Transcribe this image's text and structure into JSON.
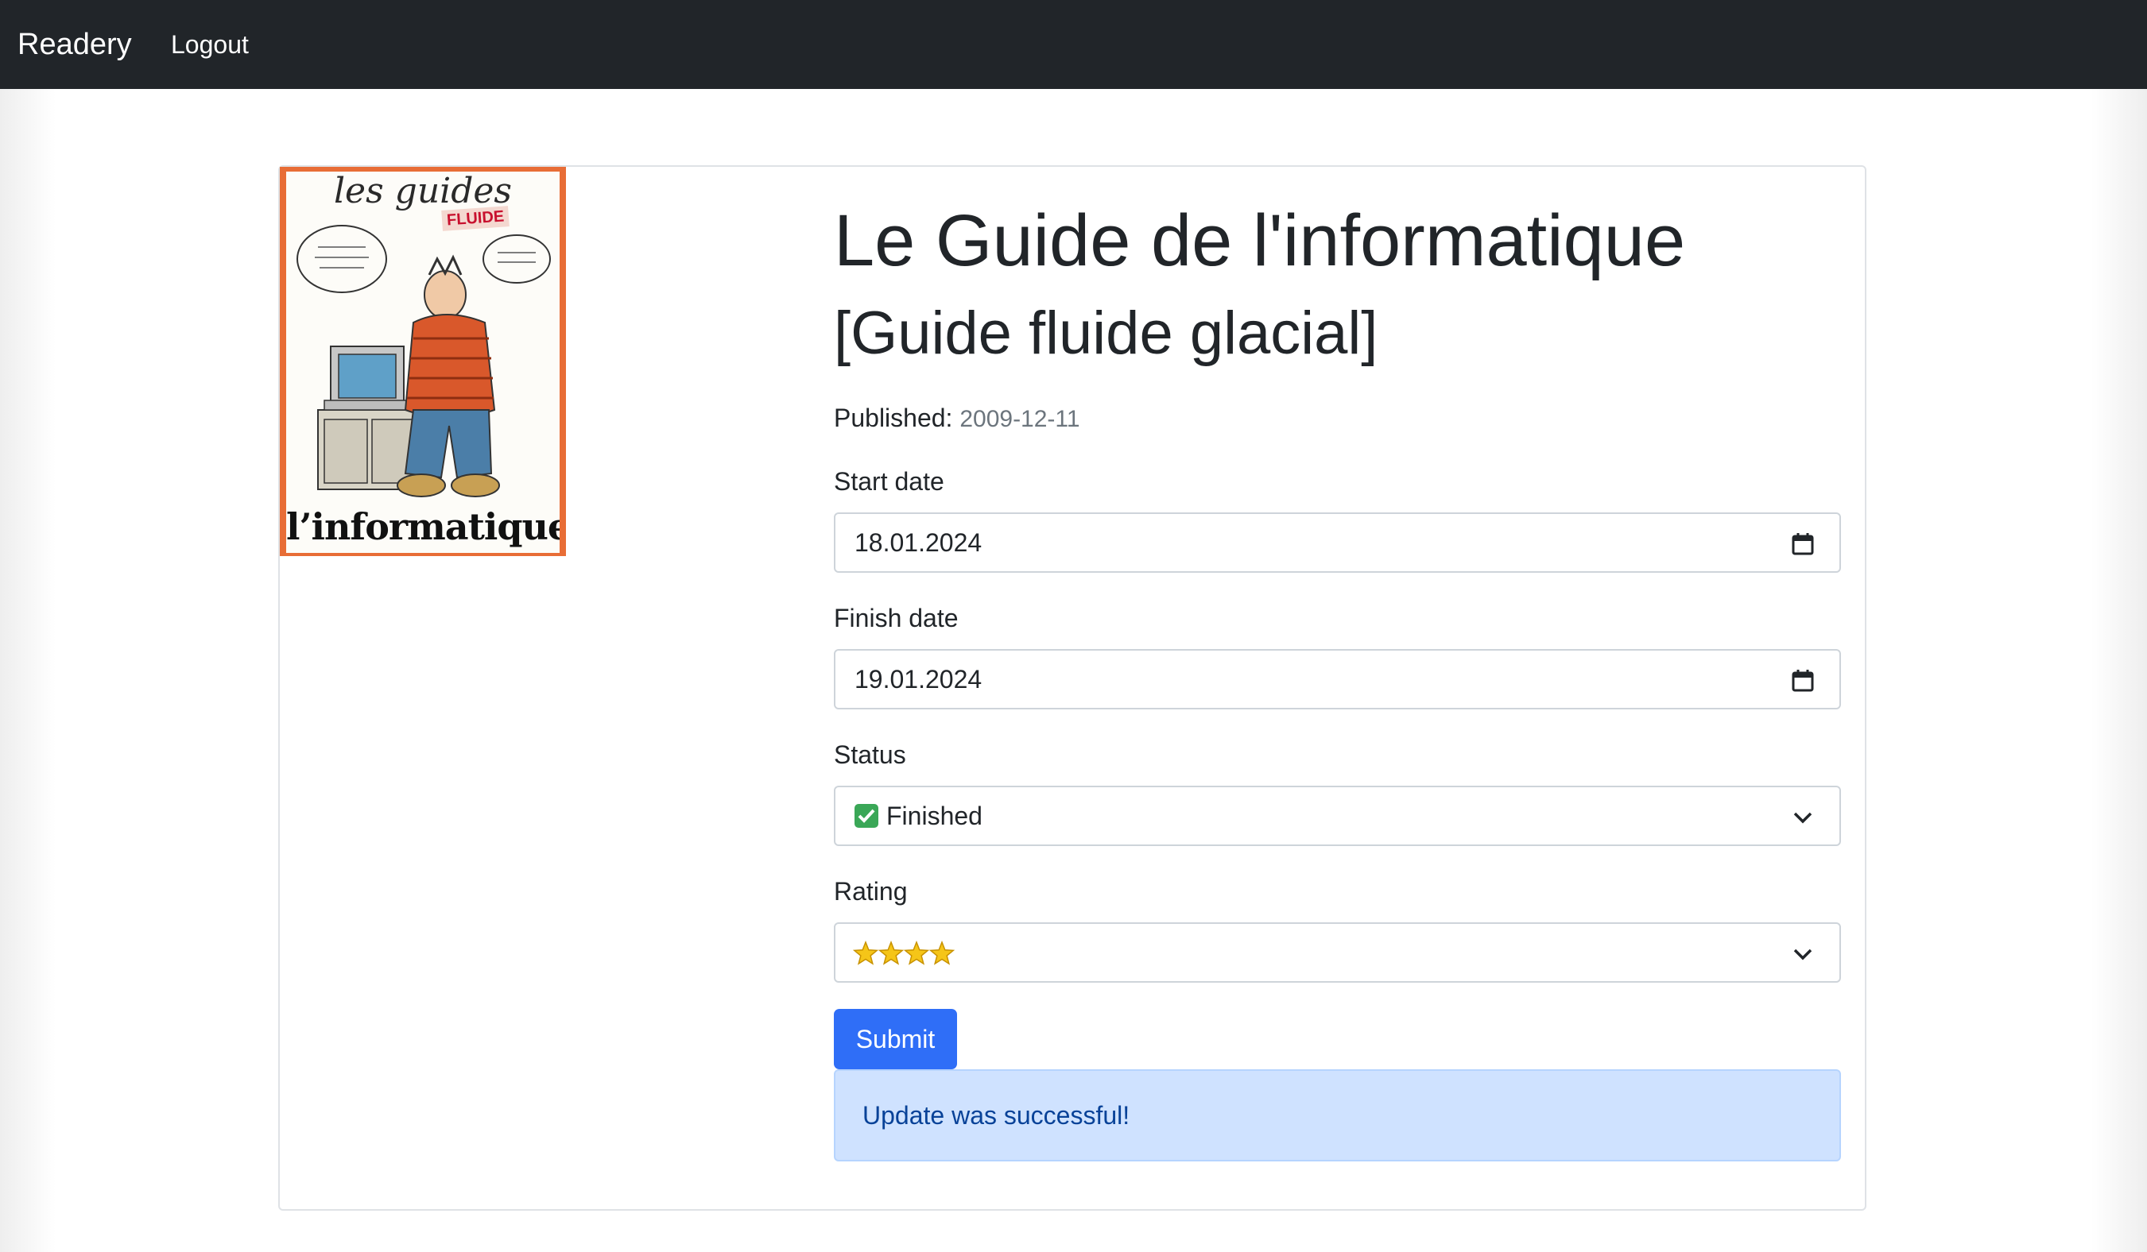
{
  "navbar": {
    "brand": "Readery",
    "logout_label": "Logout"
  },
  "book": {
    "title": "Le Guide de l'informatique",
    "subtitle": "[Guide fluide glacial]",
    "published_label": "Published:",
    "published_date": "2009-12-11",
    "cover": {
      "top_text": "les guides",
      "badge_text": "FLUIDE",
      "bottom_text": "l’informatique"
    }
  },
  "form": {
    "start_date": {
      "label": "Start date",
      "value": "18.01.2024"
    },
    "finish_date": {
      "label": "Finish date",
      "value": "19.01.2024"
    },
    "status": {
      "label": "Status",
      "value": "Finished",
      "icon": "check-mark-icon"
    },
    "rating": {
      "label": "Rating",
      "value": "☆☆☆☆",
      "stars": 4
    },
    "submit_label": "Submit"
  },
  "alert": {
    "message": "Update was successful!"
  },
  "colors": {
    "navbar": "#212529",
    "primary": "#2f6ef7",
    "alert_bg": "#cfe2ff",
    "alert_text": "#084298",
    "status_check": "#3aa757",
    "star": "#f5c518"
  }
}
